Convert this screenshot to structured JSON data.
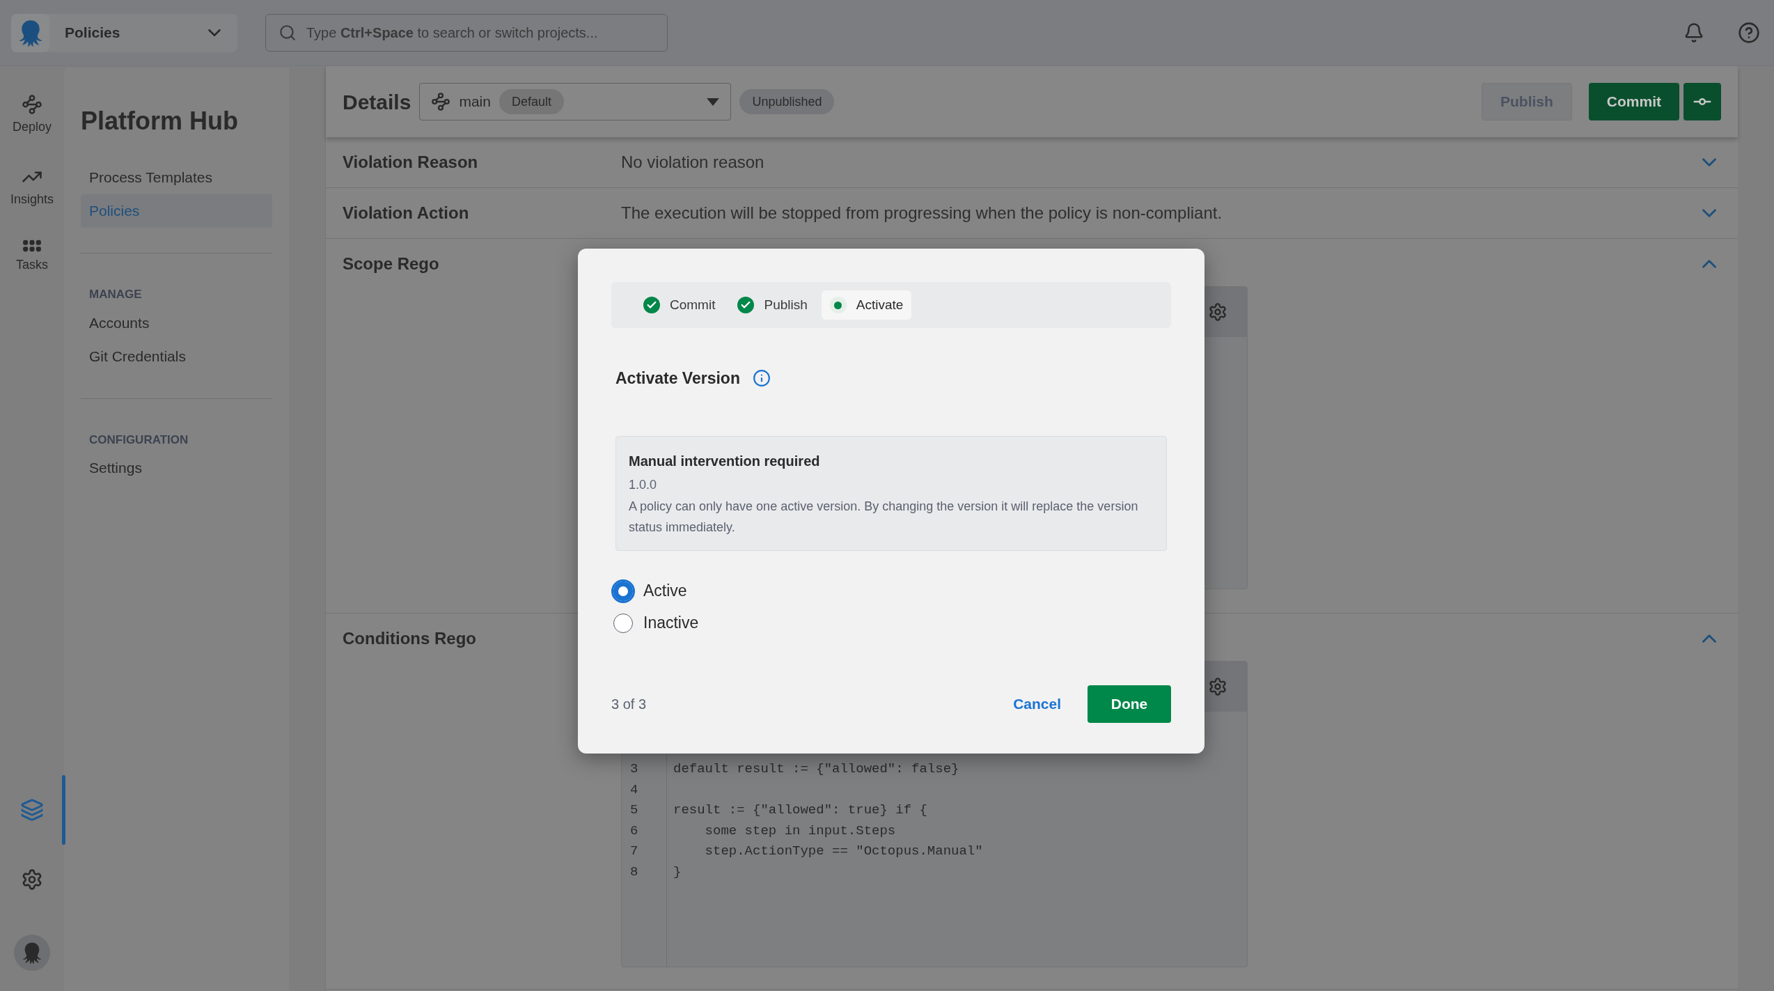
{
  "topbar": {
    "space": "Policies",
    "search": {
      "placeholder": "Type **Ctrl+Space** to search or switch projects..."
    }
  },
  "rail": {
    "items": [
      {
        "kind": "deploy",
        "label": "Deploy"
      },
      {
        "kind": "insights",
        "label": "Insights"
      },
      {
        "kind": "tasks",
        "label": "Tasks"
      }
    ],
    "bottom": [
      {
        "kind": "layers",
        "selected": true
      },
      {
        "kind": "settings",
        "selected": false
      }
    ]
  },
  "sidebar": {
    "title": "Platform Hub",
    "nav": [
      {
        "label": "Process Templates",
        "selected": false
      },
      {
        "label": "Policies",
        "selected": true
      }
    ],
    "sections": [
      {
        "heading": "MANAGE",
        "items": [
          {
            "label": "Accounts",
            "selected": false
          },
          {
            "label": "Git Credentials",
            "selected": false
          }
        ]
      },
      {
        "heading": "CONFIGURATION",
        "items": [
          {
            "label": "Settings",
            "selected": false
          }
        ]
      }
    ]
  },
  "details": {
    "title": "Details",
    "branch": {
      "name": "main",
      "badge": "Default"
    },
    "status": "Unpublished",
    "publish": {
      "label": "Publish",
      "disabled": true
    },
    "commit": {
      "label": "Commit"
    }
  },
  "rows": [
    {
      "kind": "text",
      "label": "Violation Reason",
      "value": "No violation reason",
      "expanded": false
    },
    {
      "kind": "text",
      "label": "Violation Action",
      "value": "The execution will be stopped from progressing when the policy is non-compliant.",
      "expanded": false
    },
    {
      "kind": "editor",
      "label": "Scope Rego",
      "expanded": true
    },
    {
      "kind": "editor",
      "label": "Conditions Rego",
      "expanded": true,
      "code": [
        {
          "number": "3",
          "text": "default result := {\"allowed\": false}"
        },
        {
          "number": "4"
        },
        {
          "number": "5",
          "text": "result := {\"allowed\": true} if {"
        },
        {
          "number": "6",
          "text": "    some step in input.Steps"
        },
        {
          "number": "7",
          "text": "    step.ActionType == \"Octopus.Manual\""
        },
        {
          "number": "8",
          "text": "}"
        }
      ]
    }
  ],
  "modal": {
    "steps": [
      {
        "label": "Commit",
        "done": true,
        "selected": false
      },
      {
        "label": "Publish",
        "done": true,
        "selected": false
      },
      {
        "label": "Activate",
        "done": false,
        "selected": true
      }
    ],
    "title": "Activate Version",
    "notice": {
      "title": "Manual intervention required",
      "version": "1.0.0",
      "text": "A policy can only have one active version. By changing the version it will replace the version status immediately."
    },
    "options": [
      {
        "label": "Active",
        "selected": true
      },
      {
        "label": "Inactive",
        "selected": false
      }
    ],
    "counter": "3 of 3",
    "cancel": "Cancel",
    "done": "Done"
  }
}
